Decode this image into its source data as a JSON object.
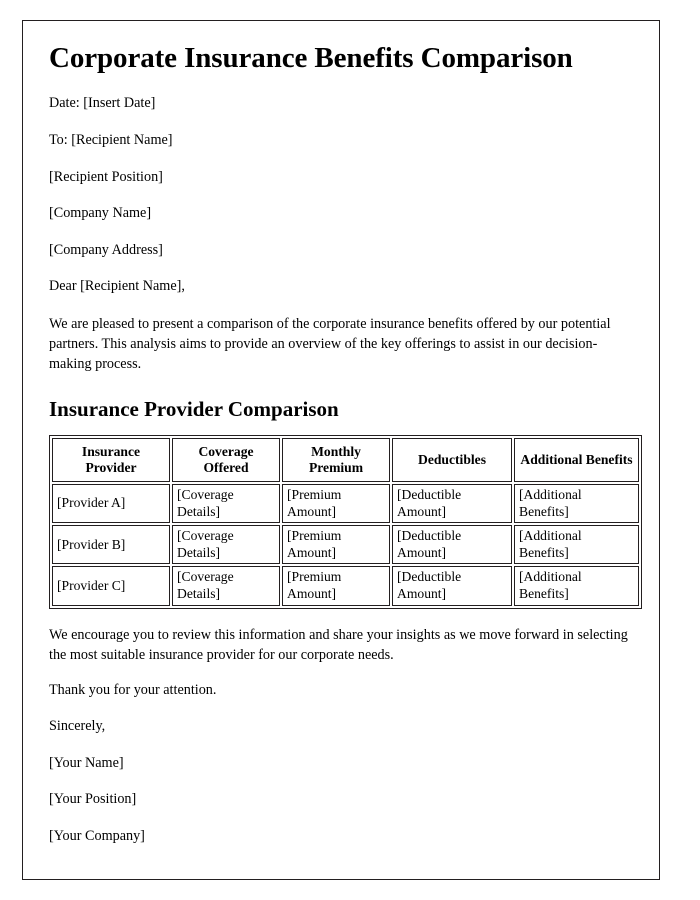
{
  "document": {
    "title": "Corporate Insurance Benefits Comparison",
    "header_lines": [
      "Date: [Insert Date]",
      "To: [Recipient Name]",
      "[Recipient Position]",
      "[Company Name]",
      "[Company Address]",
      "Dear [Recipient Name],"
    ],
    "intro_paragraph": "We are pleased to present a comparison of the corporate insurance benefits offered by our potential partners. This analysis aims to provide an overview of the key offerings to assist in our decision-making process.",
    "section_title": "Insurance Provider Comparison",
    "table": {
      "columns": [
        "Insurance Provider",
        "Coverage Offered",
        "Monthly Premium",
        "Deductibles",
        "Additional Benefits"
      ],
      "rows": [
        [
          "[Provider A]",
          "[Coverage Details]",
          "[Premium Amount]",
          "[Deductible Amount]",
          "[Additional Benefits]"
        ],
        [
          "[Provider B]",
          "[Coverage Details]",
          "[Premium Amount]",
          "[Deductible Amount]",
          "[Additional Benefits]"
        ],
        [
          "[Provider C]",
          "[Coverage Details]",
          "[Premium Amount]",
          "[Deductible Amount]",
          "[Additional Benefits]"
        ]
      ]
    },
    "closing_paragraph": "We encourage you to review this information and share your insights as we move forward in selecting the most suitable insurance provider for our corporate needs.",
    "thanks_line": "Thank you for your attention.",
    "signoff_lines": [
      "Sincerely,",
      "[Your Name]",
      "[Your Position]",
      "[Your Company]"
    ]
  },
  "style": {
    "text_color": "#000000",
    "page_background": "#ffffff",
    "border_color": "#231f20"
  }
}
